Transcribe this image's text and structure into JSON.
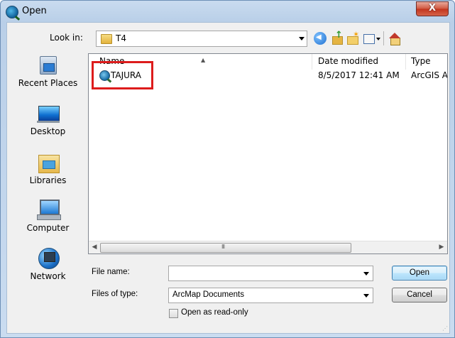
{
  "window": {
    "title": "Open",
    "close_label": "X"
  },
  "toolbar": {
    "lookin_label": "Look in:",
    "lookin_value": "T4"
  },
  "places": [
    {
      "label": "Recent Places",
      "icon": "recent-places-icon"
    },
    {
      "label": "Desktop",
      "icon": "desktop-icon"
    },
    {
      "label": "Libraries",
      "icon": "libraries-icon"
    },
    {
      "label": "Computer",
      "icon": "computer-icon"
    },
    {
      "label": "Network",
      "icon": "network-icon"
    }
  ],
  "filelist": {
    "columns": [
      "Name",
      "Date modified",
      "Type"
    ],
    "rows": [
      {
        "name": "TAJURA",
        "date": "8/5/2017 12:41 AM",
        "type": "ArcGIS Arc"
      }
    ],
    "scroll_grip": "III"
  },
  "form": {
    "filename_label": "File name:",
    "filename_value": "",
    "filetype_label": "Files of type:",
    "filetype_value": "ArcMap Documents",
    "readonly_label": "Open as read-only",
    "open_button": "Open",
    "cancel_button": "Cancel"
  },
  "colors": {
    "highlight": "#dd1c1c",
    "title_bg": "#c9dbef",
    "close_button": "#c2341d"
  }
}
